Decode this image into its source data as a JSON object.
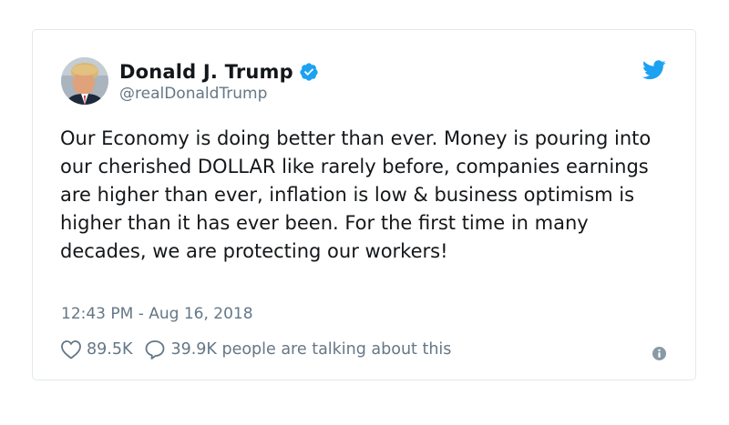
{
  "tweet": {
    "author": {
      "display_name": "Donald J. Trump",
      "handle": "@realDonaldTrump",
      "verified": true,
      "avatar_icon": "profile-photo",
      "verified_icon": "verified-badge-icon"
    },
    "text": "Our Economy is doing better than ever. Money is pouring into our cherished DOLLAR like rarely before, companies earnings are higher than ever, inflation is low & business optimism is higher than it has ever been. For the first time in many decades, we are protecting our workers!",
    "timestamp": "12:43 PM - Aug 16, 2018",
    "likes": "89.5K",
    "replies_text": "39.9K people are talking about this"
  },
  "icons": {
    "brand": "twitter-bird-icon",
    "like": "heart-icon",
    "reply": "speech-bubble-icon",
    "info": "info-icon"
  },
  "colors": {
    "brand_blue": "#1da1f2",
    "text_primary": "#14171a",
    "text_secondary": "#657786",
    "border": "#e1e8ed"
  }
}
